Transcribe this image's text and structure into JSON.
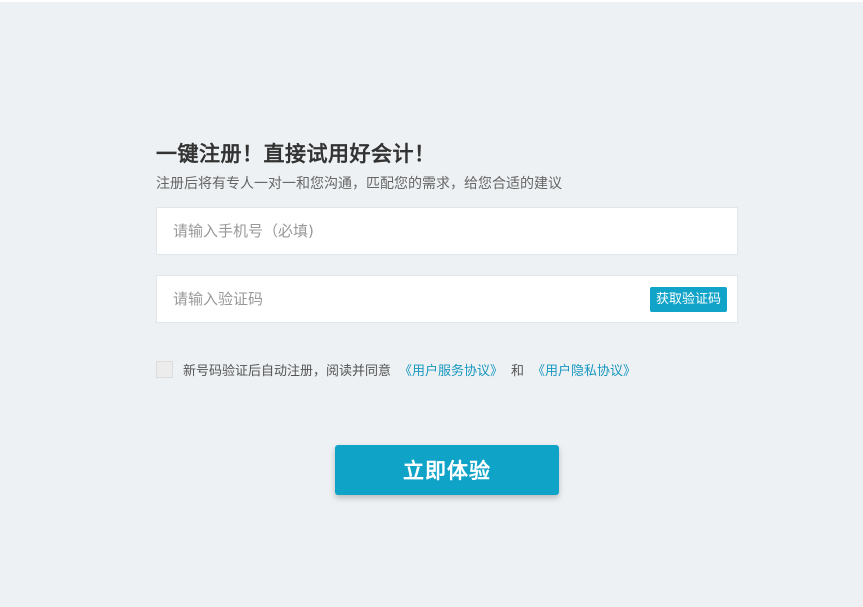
{
  "form": {
    "title": "一键注册！直接试用好会计！",
    "subtitle": "注册后将有专人一对一和您沟通，匹配您的需求，给您合适的建议",
    "phone": {
      "value": "",
      "placeholder": "请输入手机号（必填)"
    },
    "code": {
      "value": "",
      "placeholder": "请输入验证码",
      "button_label": "获取验证码"
    },
    "agreement": {
      "text": "新号码验证后自动注册，阅读并同意",
      "link_service": "《用户服务协议》",
      "and": "和",
      "link_privacy": "《用户隐私协议》",
      "checked": false
    },
    "submit_label": "立即体验"
  },
  "colors": {
    "background": "#edf1f3",
    "accent": "#0fa3c7",
    "link": "#1897c0"
  }
}
